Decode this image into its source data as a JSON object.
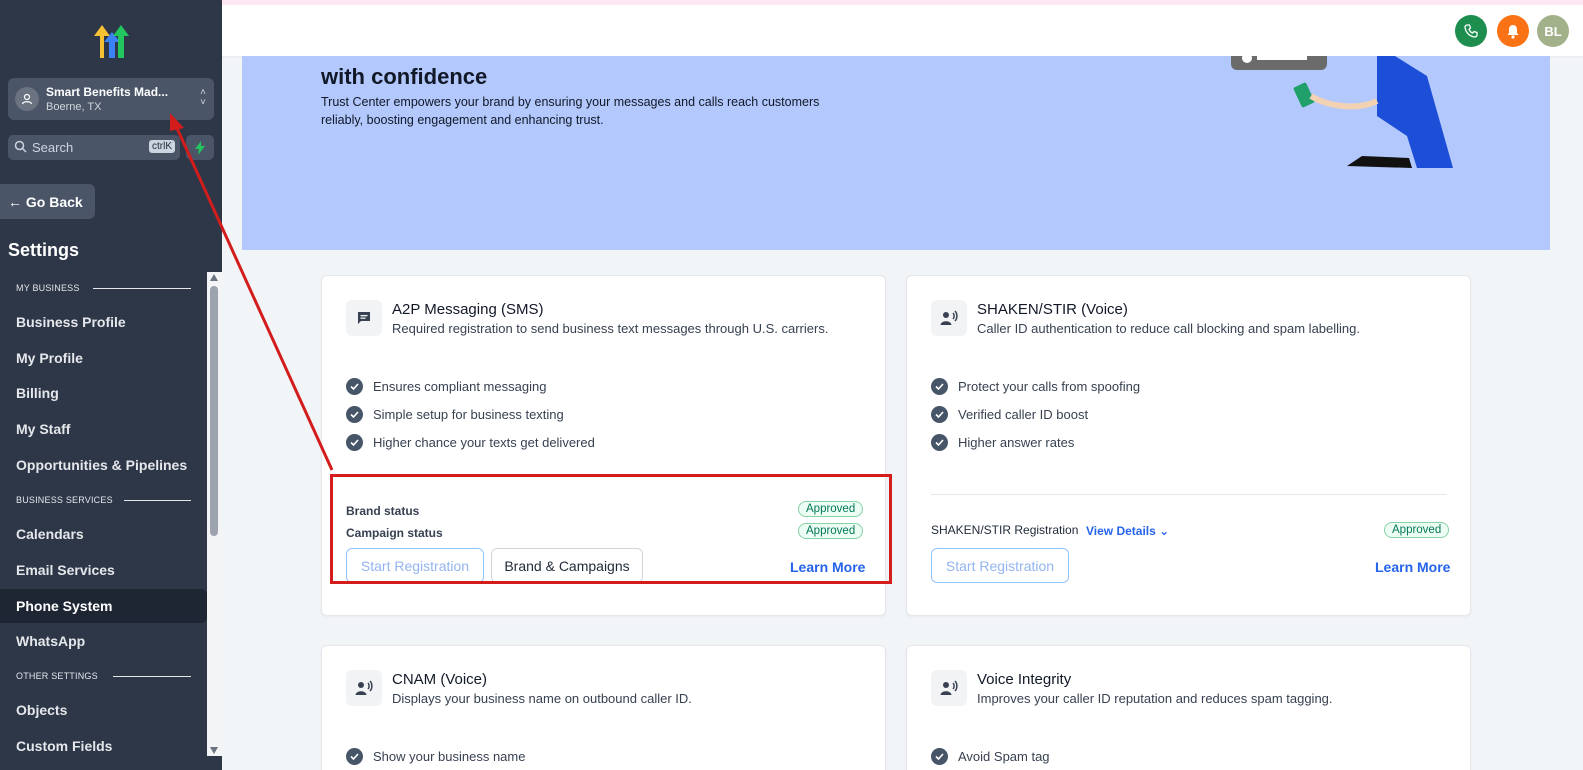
{
  "sidebar": {
    "location": {
      "name": "Smart Benefits Mad...",
      "city": "Boerne, TX"
    },
    "search": {
      "placeholder": "Search",
      "shortcut": "ctrlK"
    },
    "go_back": "Go Back",
    "settings_title": "Settings",
    "sections": {
      "my_business": "MY BUSINESS",
      "business_services": "BUSINESS SERVICES",
      "other_settings": "OTHER SETTINGS"
    },
    "items": [
      {
        "label": "Business Profile"
      },
      {
        "label": "My Profile"
      },
      {
        "label": "Billing"
      },
      {
        "label": "My Staff"
      },
      {
        "label": "Opportunities & Pipelines"
      },
      {
        "label": "Calendars"
      },
      {
        "label": "Email Services"
      },
      {
        "label": "Phone System",
        "active": true
      },
      {
        "label": "WhatsApp"
      },
      {
        "label": "Objects"
      },
      {
        "label": "Custom Fields"
      }
    ]
  },
  "topbar": {
    "avatar_initials": "BL",
    "colors": {
      "phone": "#1e8e4e",
      "bell": "#f97316",
      "avatar": "#a3b18a"
    }
  },
  "hero": {
    "heading": "with confidence",
    "description": "Trust Center empowers your brand by ensuring your messages and calls reach customers reliably, boosting engagement and enhancing trust."
  },
  "cards": {
    "a2p": {
      "title": "A2P Messaging (SMS)",
      "subtitle": "Required registration to send business text messages through U.S. carriers.",
      "features": [
        "Ensures compliant messaging",
        "Simple setup for business texting",
        "Higher chance your texts get delivered"
      ],
      "brand_status_label": "Brand status",
      "brand_status": "Approved",
      "campaign_status_label": "Campaign status",
      "campaign_status": "Approved",
      "start_button": "Start Registration",
      "brand_button": "Brand & Campaigns",
      "learn_more": "Learn More"
    },
    "shaken": {
      "title": "SHAKEN/STIR (Voice)",
      "subtitle": "Caller ID authentication to reduce call blocking and spam labelling.",
      "features": [
        "Protect your calls from spoofing",
        "Verified caller ID boost",
        "Higher answer rates"
      ],
      "registration_label": "SHAKEN/STIR Registration",
      "view_details": "View Details",
      "status": "Approved",
      "start_button": "Start Registration",
      "learn_more": "Learn More"
    },
    "cnam": {
      "title": "CNAM (Voice)",
      "subtitle": "Displays your business name on outbound caller ID.",
      "features": [
        "Show your business name"
      ]
    },
    "voice_integrity": {
      "title": "Voice Integrity",
      "subtitle": "Improves your caller ID reputation and reduces spam tagging.",
      "features": [
        "Avoid Spam tag"
      ]
    }
  },
  "annotation": {
    "color": "#d31c1c"
  }
}
